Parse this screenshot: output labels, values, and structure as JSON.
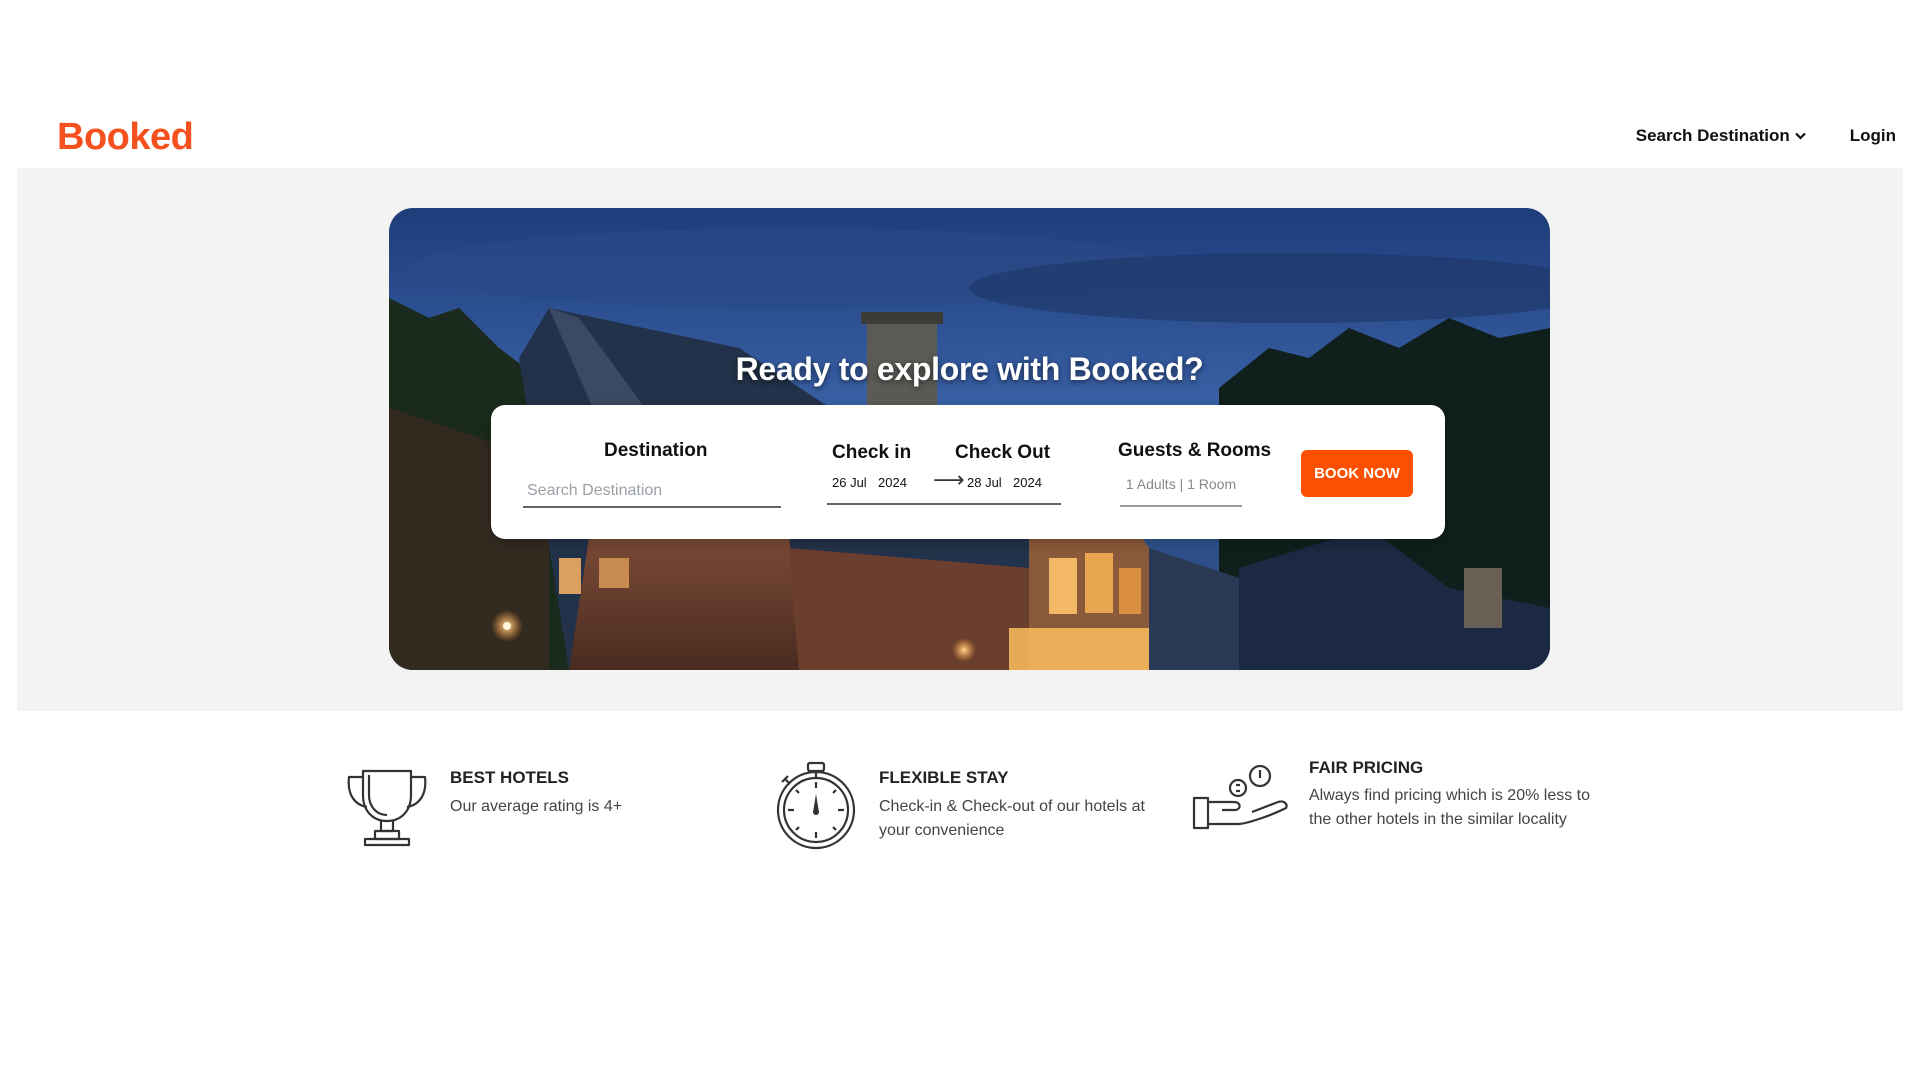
{
  "navbar": {
    "logo": "Booked",
    "dropdown_label": "Search Destination",
    "login_label": "Login"
  },
  "hero": {
    "title": "Ready to explore with Booked?"
  },
  "search": {
    "destination_label": "Destination",
    "destination_placeholder": "Search Destination",
    "checkin_label": "Check in",
    "checkout_label": "Check Out",
    "checkin_day": "26 Jul",
    "checkin_year": "2024",
    "checkout_day": "28 Jul",
    "checkout_year": "2024",
    "arrow": "⟶",
    "guests_label": "Guests & Rooms",
    "guests_value": "1 Adults | 1 Room",
    "book_label": "BOOK NOW"
  },
  "features": [
    {
      "icon": "trophy-icon",
      "title": "BEST HOTELS",
      "text": "Our average rating is 4+"
    },
    {
      "icon": "stopwatch-icon",
      "title": "FLEXIBLE STAY",
      "text": "Check-in & Check-out of our hotels at your convenience"
    },
    {
      "icon": "coin-hand-icon",
      "title": "FAIR PRICING",
      "text": "Always find pricing which is 20% less to the other hotels in the similar locality"
    }
  ],
  "colors": {
    "brand": "#f4511e",
    "button": "#fc5000"
  }
}
